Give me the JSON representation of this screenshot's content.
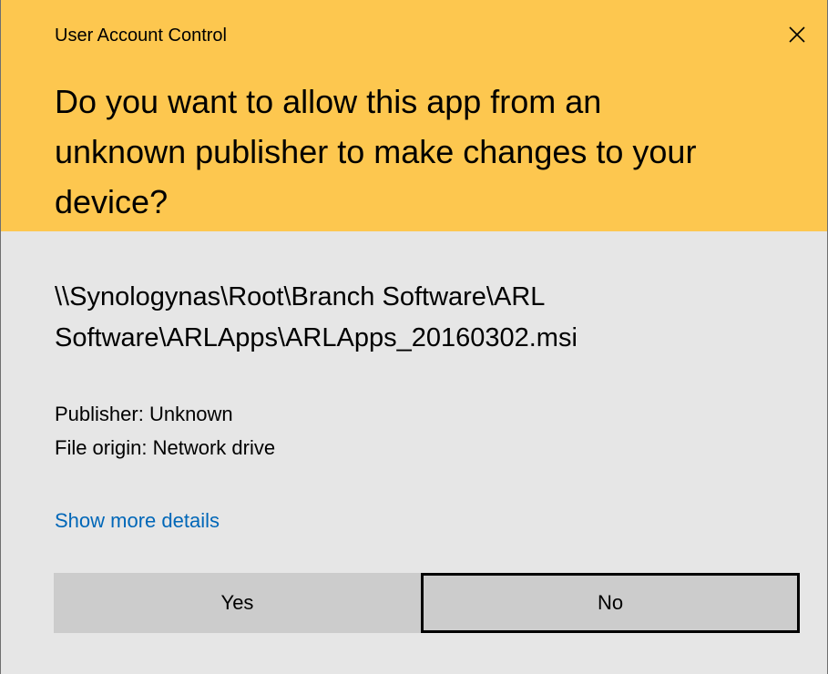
{
  "window": {
    "title": "User Account Control",
    "close_icon": "close-icon"
  },
  "header": {
    "question_lines": [
      "Do you want to allow this app from an",
      "unknown publisher to make changes to your",
      "device?"
    ],
    "background_color": "#fdc74f"
  },
  "program": {
    "path_lines": [
      "\\\\Synologynas\\Root\\Branch Software\\ARL",
      "Software\\ARLApps\\ARLApps_20160302.msi"
    ],
    "publisher": "Publisher: Unknown",
    "file_origin": "File origin: Network drive"
  },
  "details_link": {
    "label": "Show more details",
    "color": "#0067b8"
  },
  "buttons": {
    "yes_label": "Yes",
    "no_label": "No",
    "focused": "No"
  },
  "colors": {
    "body_background": "#e6e6e6",
    "button_background": "#cccccc"
  }
}
